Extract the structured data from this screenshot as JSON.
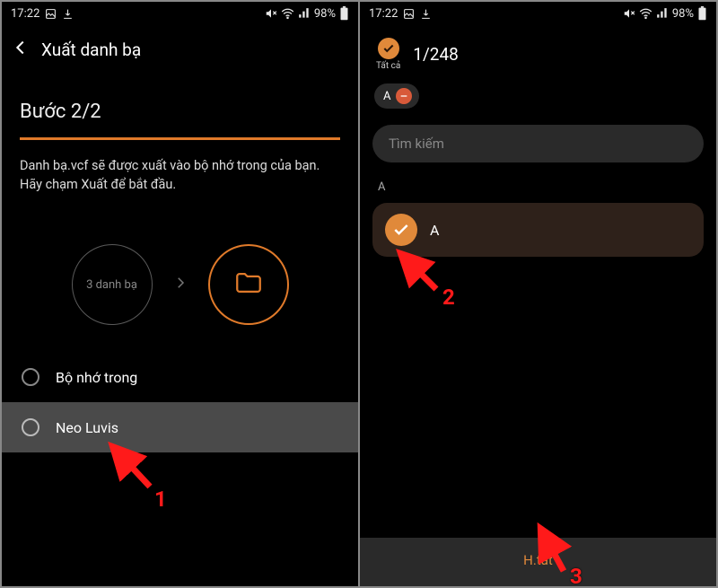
{
  "left": {
    "status": {
      "time": "17:22",
      "battery": "98%"
    },
    "header": {
      "title": "Xuất danh bạ"
    },
    "step_label": "Bước 2/2",
    "desc": "Danh bạ.vcf sẽ được xuất vào bộ nhớ trong của bạn. Hãy chạm Xuất để bắt đầu.",
    "circle_count_label": "3 danh bạ",
    "options": [
      {
        "label": "Bộ nhớ trong"
      },
      {
        "label": "Neo Luvis"
      }
    ]
  },
  "right": {
    "status": {
      "time": "17:22",
      "battery": "98%"
    },
    "select_all_label": "Tất cả",
    "counter": "1/248",
    "chip_letter": "A",
    "search_placeholder": "Tìm kiếm",
    "section_letter": "A",
    "contact_name": "A",
    "done_label": "H.tất"
  },
  "annotations": {
    "n1": "1",
    "n2": "2",
    "n3": "3"
  }
}
